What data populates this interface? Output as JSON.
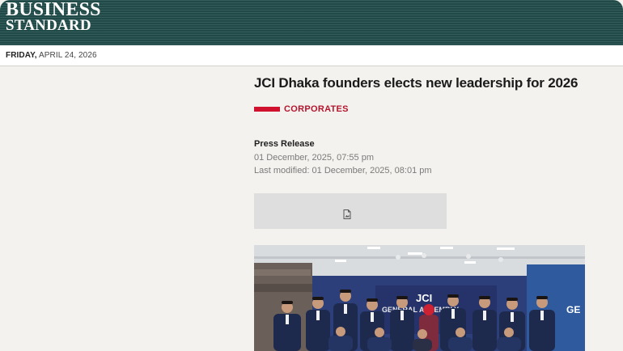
{
  "header": {
    "logo_line1": "BUSINESS",
    "logo_line2": "STANDARD"
  },
  "datebar": {
    "day": "FRIDAY,",
    "date": " APRIL 24, 2026"
  },
  "article": {
    "headline": "JCI Dhaka founders elects new leadership for 2026",
    "category": "CORPORATES",
    "author": "Press Release",
    "published": "01 December, 2025, 07:55 pm",
    "modified": "Last modified: 01 December, 2025, 08:01 pm"
  },
  "photo": {
    "backdrop_logo": "JCI",
    "backdrop_text": "GENERAL ASSEMBLY",
    "side_text": "GE"
  },
  "colors": {
    "masthead": "#1f4a48",
    "accent": "#d0122e",
    "background": "#f4f2ee"
  },
  "icons": {
    "ad_placeholder": "document-image-icon"
  }
}
